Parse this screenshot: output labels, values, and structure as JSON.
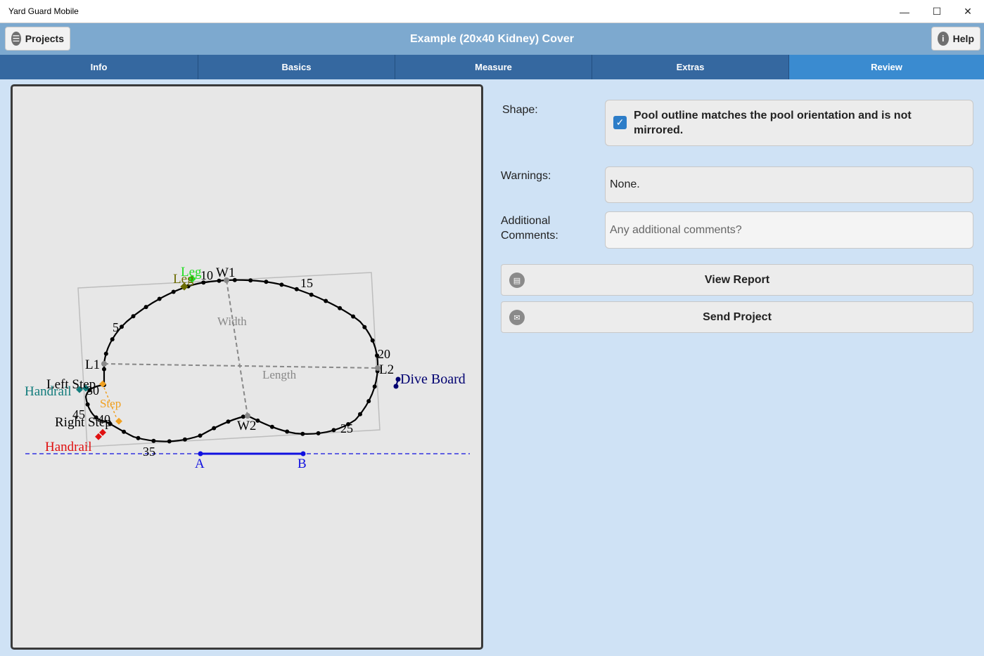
{
  "window": {
    "title": "Yard Guard Mobile",
    "minimize": "—",
    "maximize": "☐",
    "close": "✕"
  },
  "header": {
    "title": "Example (20x40 Kidney) Cover",
    "projects_label": "Projects",
    "help_label": "Help"
  },
  "tabs": [
    {
      "label": "Info",
      "active": false
    },
    {
      "label": "Basics",
      "active": false
    },
    {
      "label": "Measure",
      "active": false
    },
    {
      "label": "Extras",
      "active": false
    },
    {
      "label": "Review",
      "active": true
    }
  ],
  "diagram": {
    "labels": {
      "w1": "W1",
      "w2": "W2",
      "l1": "L1",
      "l2": "L2",
      "width": "Width",
      "length": "Length",
      "n5": "5",
      "n10": "10",
      "n15": "15",
      "n20": "20",
      "n25": "25",
      "n30": "30",
      "n35": "35",
      "n40": "40",
      "n45": "45",
      "leg_green": "Leg",
      "leg_olive": "Leg",
      "left_step": "Left Step",
      "right_step": "Right Step",
      "step": "Step",
      "handrail_teal": "Handrail",
      "handrail_red": "Handrail",
      "dive_board": "Dive Board",
      "a": "A",
      "b": "B"
    },
    "colors": {
      "outline": "#000000",
      "guide": "#888888",
      "leg_green": "#22dd22",
      "leg_olive": "#6b6b00",
      "step": "#f0a020",
      "handrail_teal": "#127c7c",
      "handrail_red": "#e01010",
      "dive": "#000070",
      "baseline": "#1010e0"
    }
  },
  "review": {
    "shape_label": "Shape:",
    "shape_checked": true,
    "shape_text": "Pool outline matches the pool orientation and is not mirrored.",
    "warnings_label": "Warnings:",
    "warnings_value": "None.",
    "comments_label_line1": "Additional",
    "comments_label_line2": "Comments:",
    "comments_placeholder": "Any additional comments?",
    "comments_value": "",
    "view_report_label": "View Report",
    "send_project_label": "Send Project"
  }
}
